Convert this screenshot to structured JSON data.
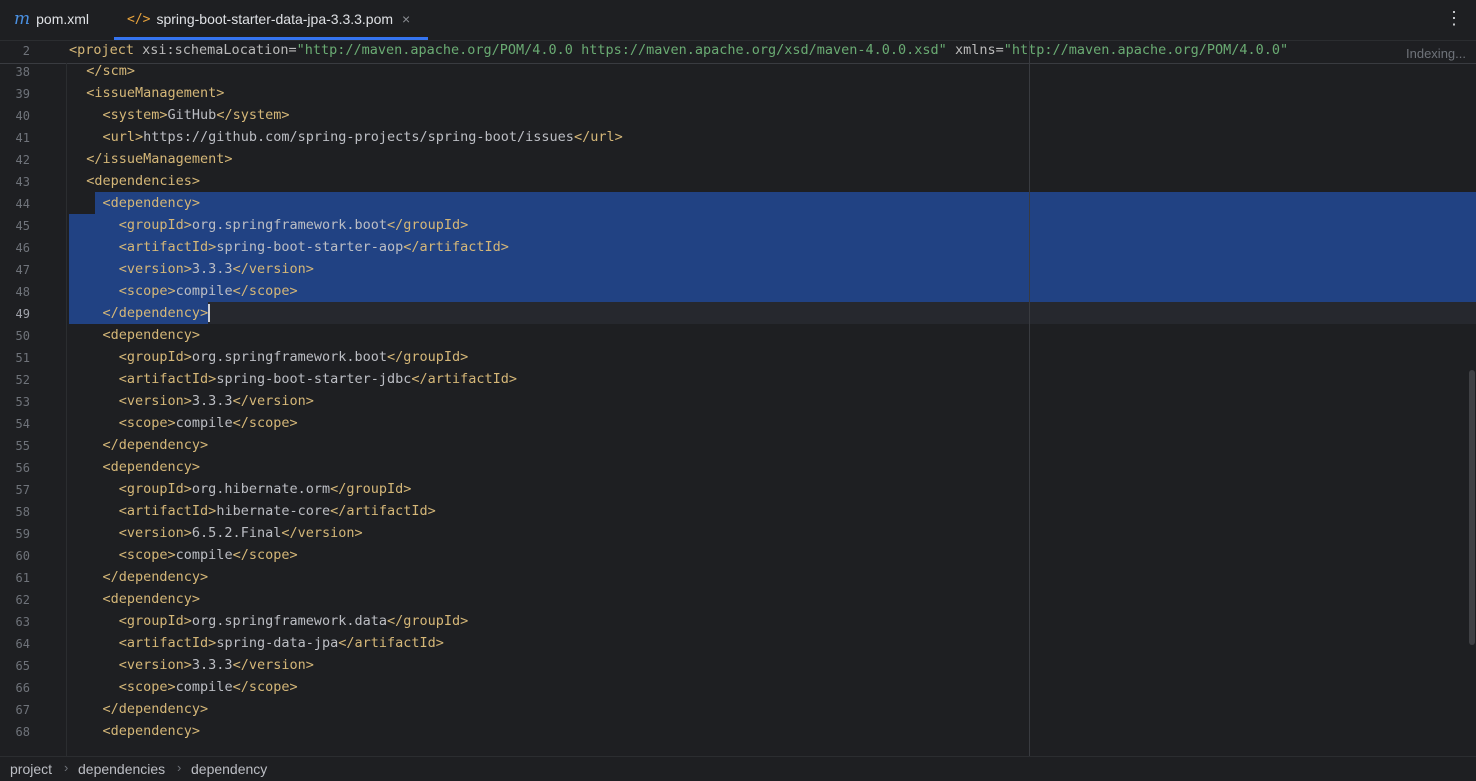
{
  "tabs": [
    {
      "label": "pom.xml",
      "icon": "maven-m-icon",
      "active": false
    },
    {
      "label": "spring-boot-starter-data-jpa-3.3.3.pom",
      "icon": "xml-tag-icon",
      "active": true
    }
  ],
  "tab_close_glyph": "×",
  "menu_glyph": "⋮",
  "sticky": {
    "line_number": "2",
    "parts": [
      {
        "t": "<project ",
        "c": "tag"
      },
      {
        "t": "xsi:schemaLocation=",
        "c": "attr"
      },
      {
        "t": "\"http://maven.apache.org/POM/4.0.0 https://maven.apache.org/xsd/maven-4.0.0.xsd\"",
        "c": "str"
      },
      {
        "t": " xmlns=",
        "c": "attr"
      },
      {
        "t": "\"http://maven.apache.org/POM/4.0.0\"",
        "c": "str"
      }
    ]
  },
  "indexing_label": "Indexing...",
  "lines": [
    {
      "n": "38",
      "indent": 1,
      "parts": [
        {
          "t": "</scm>",
          "c": "tag"
        }
      ]
    },
    {
      "n": "39",
      "indent": 1,
      "parts": [
        {
          "t": "<issueManagement>",
          "c": "tag"
        }
      ]
    },
    {
      "n": "40",
      "indent": 2,
      "parts": [
        {
          "t": "<system>",
          "c": "tag"
        },
        {
          "t": "GitHub",
          "c": "txt"
        },
        {
          "t": "</system>",
          "c": "tag"
        }
      ]
    },
    {
      "n": "41",
      "indent": 2,
      "parts": [
        {
          "t": "<url>",
          "c": "tag"
        },
        {
          "t": "https://github.com/spring-projects/spring-boot/issues",
          "c": "txt"
        },
        {
          "t": "</url>",
          "c": "tag"
        }
      ]
    },
    {
      "n": "42",
      "indent": 1,
      "parts": [
        {
          "t": "</issueManagement>",
          "c": "tag"
        }
      ]
    },
    {
      "n": "43",
      "indent": 1,
      "parts": [
        {
          "t": "<dependencies>",
          "c": "tag"
        }
      ]
    },
    {
      "n": "44",
      "indent": 2,
      "sel": "from-text",
      "parts": [
        {
          "t": "<dependency>",
          "c": "tag"
        }
      ]
    },
    {
      "n": "45",
      "indent": 3,
      "sel": "full",
      "parts": [
        {
          "t": "<groupId>",
          "c": "tag"
        },
        {
          "t": "org.springframework.boot",
          "c": "txt"
        },
        {
          "t": "</groupId>",
          "c": "tag"
        }
      ]
    },
    {
      "n": "46",
      "indent": 3,
      "sel": "full",
      "parts": [
        {
          "t": "<artifactId>",
          "c": "tag"
        },
        {
          "t": "spring-boot-starter-aop",
          "c": "txt"
        },
        {
          "t": "</artifactId>",
          "c": "tag"
        }
      ]
    },
    {
      "n": "47",
      "indent": 3,
      "sel": "full",
      "parts": [
        {
          "t": "<version>",
          "c": "tag"
        },
        {
          "t": "3.3.3",
          "c": "txt"
        },
        {
          "t": "</version>",
          "c": "tag"
        }
      ]
    },
    {
      "n": "48",
      "indent": 3,
      "sel": "full",
      "parts": [
        {
          "t": "<scope>",
          "c": "tag"
        },
        {
          "t": "compile",
          "c": "txt"
        },
        {
          "t": "</scope>",
          "c": "tag"
        }
      ]
    },
    {
      "n": "49",
      "indent": 2,
      "sel": "to-caret",
      "caret": true,
      "parts": [
        {
          "t": "</dependency>",
          "c": "tag"
        }
      ]
    },
    {
      "n": "50",
      "indent": 2,
      "parts": [
        {
          "t": "<dependency>",
          "c": "tag"
        }
      ]
    },
    {
      "n": "51",
      "indent": 3,
      "parts": [
        {
          "t": "<groupId>",
          "c": "tag"
        },
        {
          "t": "org.springframework.boot",
          "c": "txt"
        },
        {
          "t": "</groupId>",
          "c": "tag"
        }
      ]
    },
    {
      "n": "52",
      "indent": 3,
      "parts": [
        {
          "t": "<artifactId>",
          "c": "tag"
        },
        {
          "t": "spring-boot-starter-jdbc",
          "c": "txt"
        },
        {
          "t": "</artifactId>",
          "c": "tag"
        }
      ]
    },
    {
      "n": "53",
      "indent": 3,
      "parts": [
        {
          "t": "<version>",
          "c": "tag"
        },
        {
          "t": "3.3.3",
          "c": "txt"
        },
        {
          "t": "</version>",
          "c": "tag"
        }
      ]
    },
    {
      "n": "54",
      "indent": 3,
      "parts": [
        {
          "t": "<scope>",
          "c": "tag"
        },
        {
          "t": "compile",
          "c": "txt"
        },
        {
          "t": "</scope>",
          "c": "tag"
        }
      ]
    },
    {
      "n": "55",
      "indent": 2,
      "parts": [
        {
          "t": "</dependency>",
          "c": "tag"
        }
      ]
    },
    {
      "n": "56",
      "indent": 2,
      "parts": [
        {
          "t": "<dependency>",
          "c": "tag"
        }
      ]
    },
    {
      "n": "57",
      "indent": 3,
      "parts": [
        {
          "t": "<groupId>",
          "c": "tag"
        },
        {
          "t": "org.hibernate.orm",
          "c": "txt"
        },
        {
          "t": "</groupId>",
          "c": "tag"
        }
      ]
    },
    {
      "n": "58",
      "indent": 3,
      "parts": [
        {
          "t": "<artifactId>",
          "c": "tag"
        },
        {
          "t": "hibernate-core",
          "c": "txt"
        },
        {
          "t": "</artifactId>",
          "c": "tag"
        }
      ]
    },
    {
      "n": "59",
      "indent": 3,
      "parts": [
        {
          "t": "<version>",
          "c": "tag"
        },
        {
          "t": "6.5.2.Final",
          "c": "txt"
        },
        {
          "t": "</version>",
          "c": "tag"
        }
      ]
    },
    {
      "n": "60",
      "indent": 3,
      "parts": [
        {
          "t": "<scope>",
          "c": "tag"
        },
        {
          "t": "compile",
          "c": "txt"
        },
        {
          "t": "</scope>",
          "c": "tag"
        }
      ]
    },
    {
      "n": "61",
      "indent": 2,
      "parts": [
        {
          "t": "</dependency>",
          "c": "tag"
        }
      ]
    },
    {
      "n": "62",
      "indent": 2,
      "parts": [
        {
          "t": "<dependency>",
          "c": "tag"
        }
      ]
    },
    {
      "n": "63",
      "indent": 3,
      "parts": [
        {
          "t": "<groupId>",
          "c": "tag"
        },
        {
          "t": "org.springframework.data",
          "c": "txt"
        },
        {
          "t": "</groupId>",
          "c": "tag"
        }
      ]
    },
    {
      "n": "64",
      "indent": 3,
      "parts": [
        {
          "t": "<artifactId>",
          "c": "tag"
        },
        {
          "t": "spring-data-jpa",
          "c": "txt"
        },
        {
          "t": "</artifactId>",
          "c": "tag"
        }
      ]
    },
    {
      "n": "65",
      "indent": 3,
      "parts": [
        {
          "t": "<version>",
          "c": "tag"
        },
        {
          "t": "3.3.3",
          "c": "txt"
        },
        {
          "t": "</version>",
          "c": "tag"
        }
      ]
    },
    {
      "n": "66",
      "indent": 3,
      "parts": [
        {
          "t": "<scope>",
          "c": "tag"
        },
        {
          "t": "compile",
          "c": "txt"
        },
        {
          "t": "</scope>",
          "c": "tag"
        }
      ]
    },
    {
      "n": "67",
      "indent": 2,
      "parts": [
        {
          "t": "</dependency>",
          "c": "tag"
        }
      ]
    },
    {
      "n": "68",
      "indent": 2,
      "parts": [
        {
          "t": "<dependency>",
          "c": "tag"
        }
      ]
    }
  ],
  "breadcrumbs": [
    "project",
    "dependencies",
    "dependency"
  ],
  "breadcrumb_sep": "›",
  "colors": {
    "tag": "#d5b778",
    "text": "#bcbec4",
    "string": "#6aab73",
    "selection": "#214283",
    "accent": "#3574f0"
  }
}
